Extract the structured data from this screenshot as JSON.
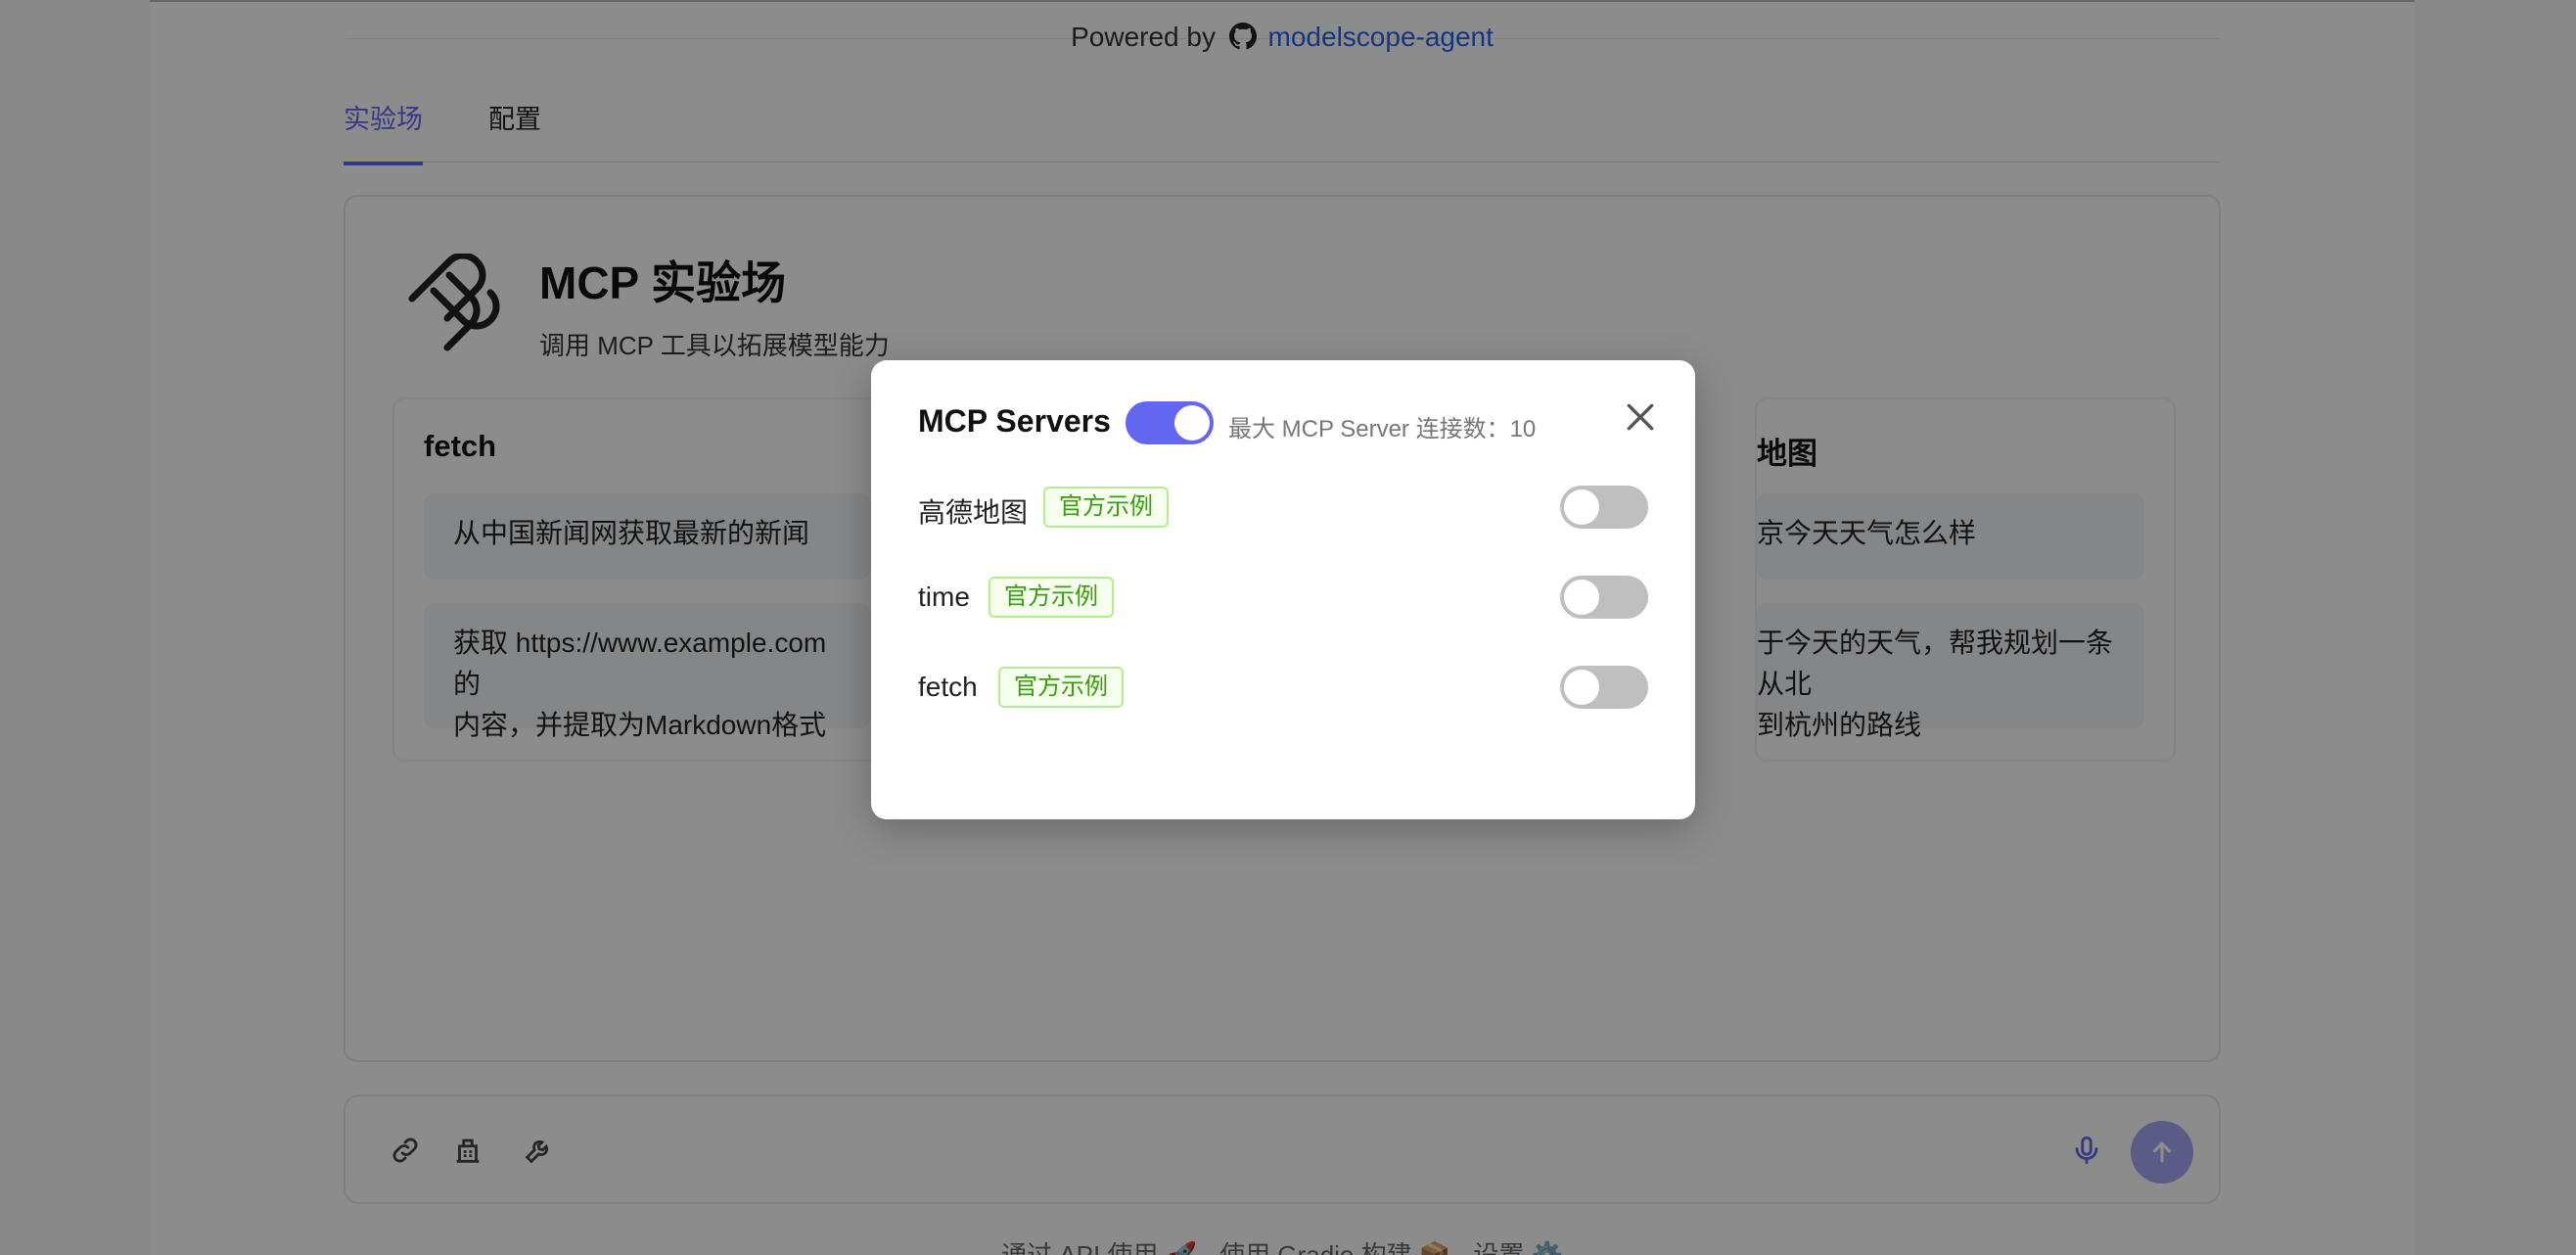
{
  "header": {
    "powered_prefix": "Powered by",
    "powered_link": "modelscope-agent"
  },
  "tabs": [
    {
      "label": "实验场",
      "active": true
    },
    {
      "label": "配置",
      "active": false
    }
  ],
  "card": {
    "title": "MCP 实验场",
    "subtitle": "调用 MCP 工具以拓展模型能力"
  },
  "examples": [
    {
      "title": "fetch",
      "items": [
        "从中国新闻网获取最新的新闻",
        "获取 https://www.example.com 的\n内容，并提取为Markdown格式"
      ]
    },
    {
      "title": "地图",
      "items": [
        "京今天天气怎么样",
        "于今天的天气，帮我规划一条从北\n到杭州的路线"
      ]
    }
  ],
  "input_bar": {
    "icons": [
      "link-icon",
      "building-icon",
      "wrench-icon",
      "microphone-icon",
      "arrow-up-icon"
    ]
  },
  "footer": {
    "text": "通过 API 使用 🚀 · 使用 Gradio 构建 📦 · 设置 ⚙️"
  },
  "modal": {
    "title": "MCP Servers",
    "master_enabled": true,
    "limit_text": "最大 MCP Server 连接数：10",
    "servers": [
      {
        "name": "高德地图",
        "tag": "官方示例",
        "enabled": false
      },
      {
        "name": "time",
        "tag": "官方示例",
        "enabled": false
      },
      {
        "name": "fetch",
        "tag": "官方示例",
        "enabled": false
      }
    ]
  },
  "colors": {
    "accent": "#6366f1",
    "link": "#2563eb",
    "tag_text": "#389e0d",
    "tag_bg": "#f6ffed",
    "toggle_off": "#bfbfbf"
  }
}
